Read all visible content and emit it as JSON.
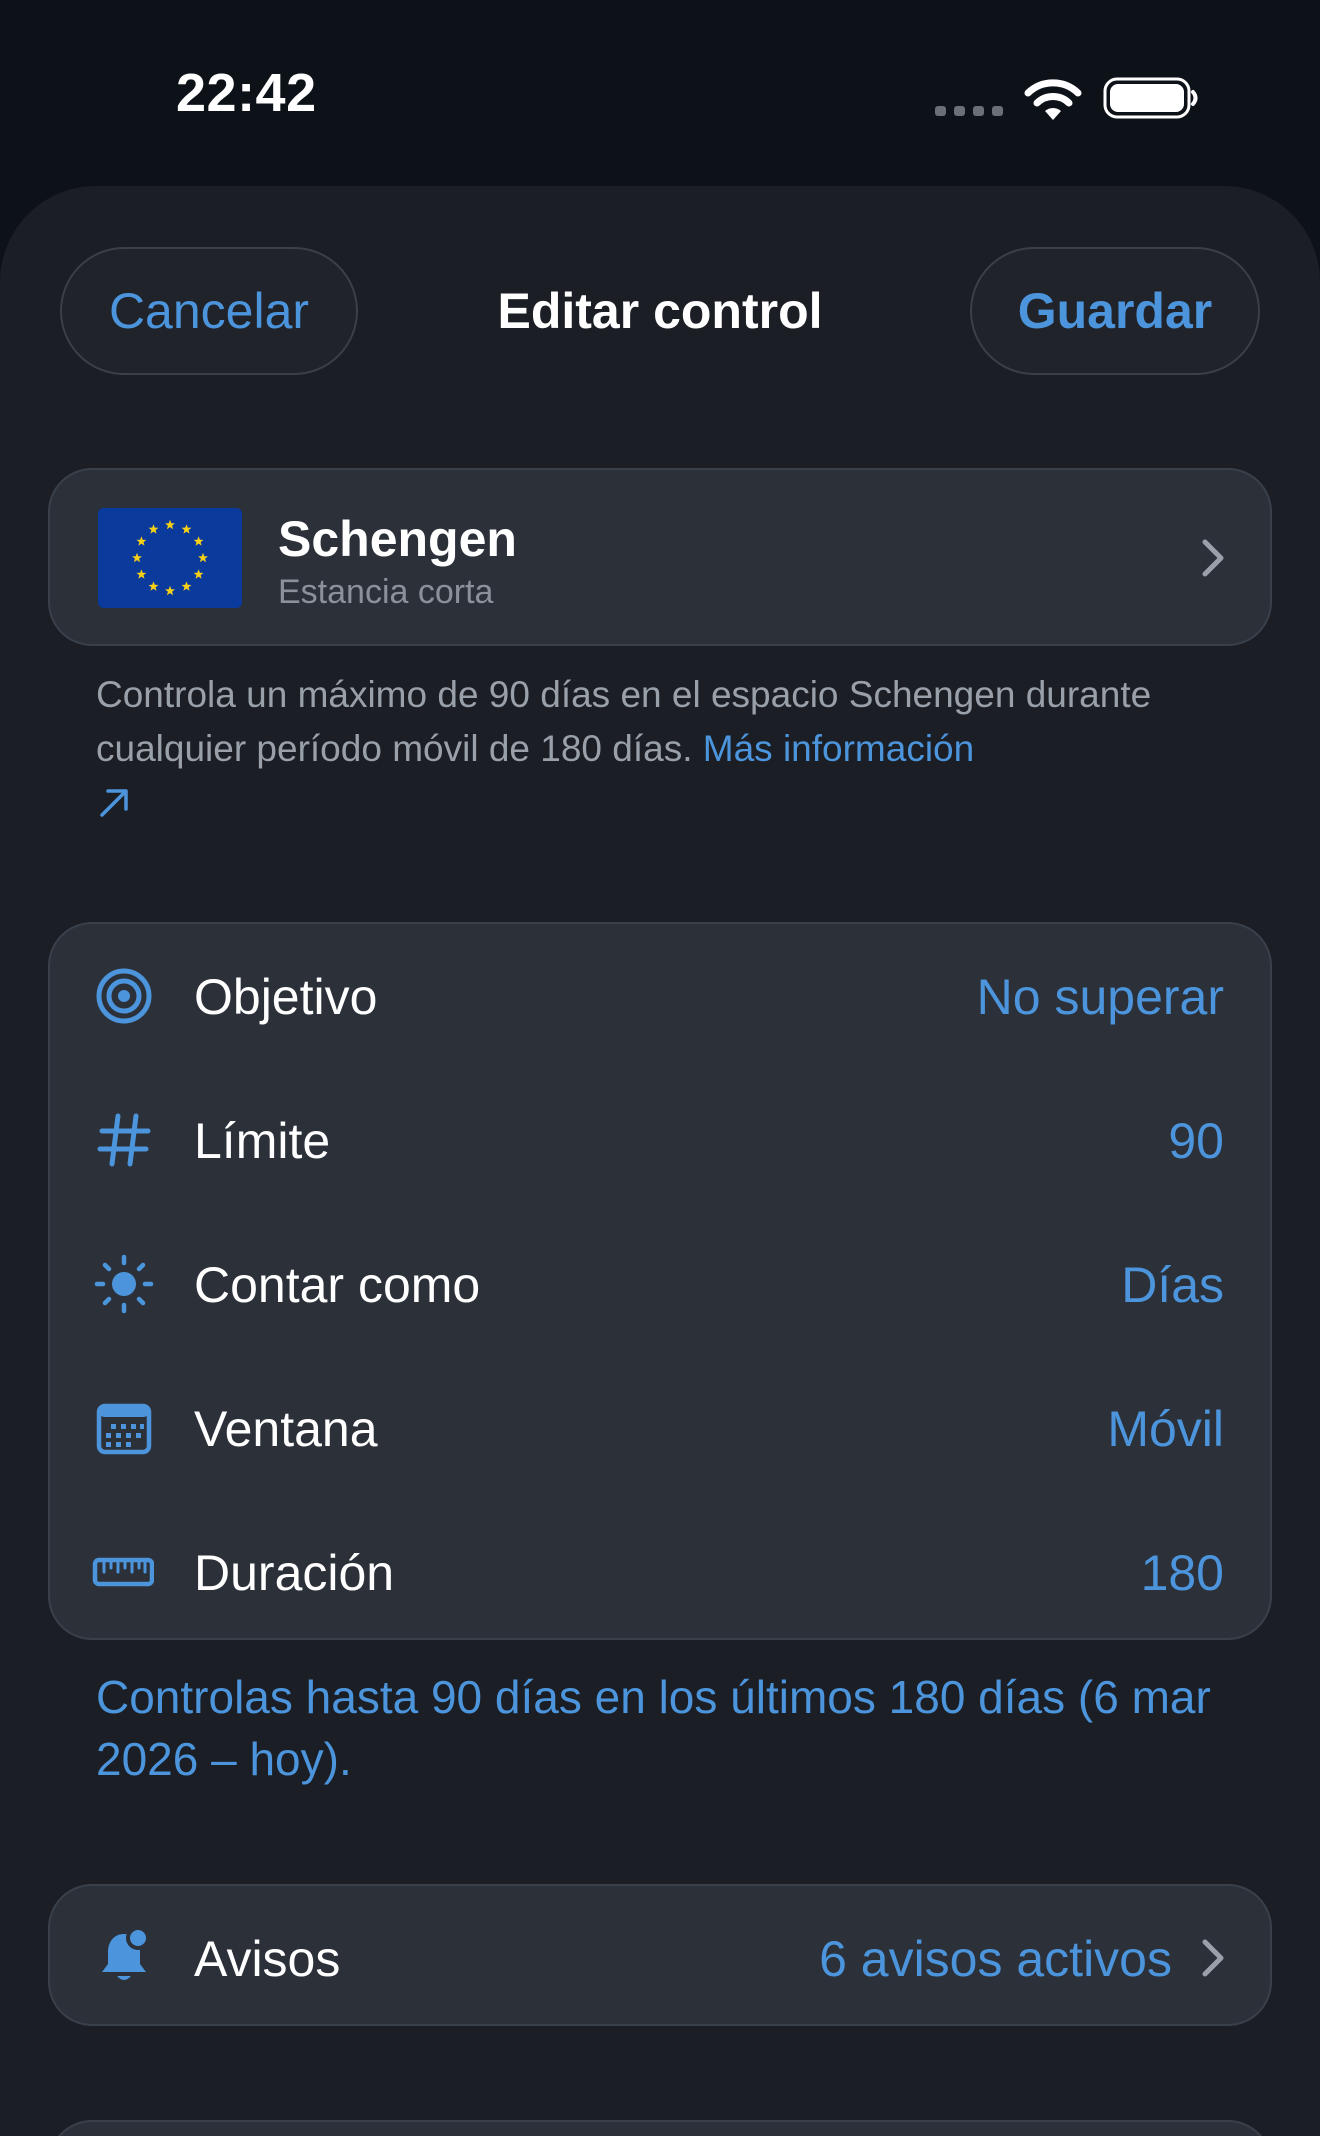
{
  "status_bar": {
    "time": "22:42"
  },
  "nav": {
    "cancel_label": "Cancelar",
    "title": "Editar control",
    "save_label": "Guardar"
  },
  "rule": {
    "title": "Schengen",
    "subtitle": "Estancia corta",
    "description": "Controla un máximo de 90 días en el espacio Schengen durante cualquier período móvil de 180 días.",
    "more_link": "Más información"
  },
  "settings": [
    {
      "label": "Objetivo",
      "value": "No superar",
      "icon": "target-icon"
    },
    {
      "label": "Límite",
      "value": "90",
      "icon": "hash-icon"
    },
    {
      "label": "Contar como",
      "value": "Días",
      "icon": "sun-icon"
    },
    {
      "label": "Ventana",
      "value": "Móvil",
      "icon": "calendar-icon"
    },
    {
      "label": "Duración",
      "value": "180",
      "icon": "ruler-icon"
    }
  ],
  "summary": "Controlas hasta 90 días en los últimos 180 días (6 mar 2026 – hoy).",
  "alerts": {
    "label": "Avisos",
    "value": "6 avisos activos",
    "icon": "bell-badge-icon"
  },
  "colors": {
    "background": "#0d1118",
    "sheet": "#1b1e24",
    "card": "#2b3039",
    "accent": "#4c95dc",
    "flag_blue": "#0b3a9d",
    "flag_star": "#f7d117"
  }
}
